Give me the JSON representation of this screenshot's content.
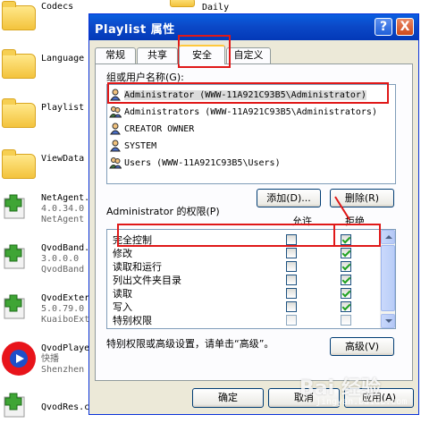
{
  "explorer": {
    "items": [
      {
        "name": "Codecs",
        "sub1": "",
        "sub2": ""
      },
      {
        "name": "Language",
        "sub1": "",
        "sub2": ""
      },
      {
        "name": "Playlist",
        "sub1": "",
        "sub2": ""
      },
      {
        "name": "ViewData",
        "sub1": "",
        "sub2": ""
      },
      {
        "name": "NetAgent.",
        "sub1": "4.0.34.0",
        "sub2": "NetAgent"
      },
      {
        "name": "QvodBand.",
        "sub1": "3.0.0.0",
        "sub2": "QvodBand"
      },
      {
        "name": "QvodExter",
        "sub1": "5.0.79.0",
        "sub2": "KuaiboExt"
      },
      {
        "name": "QvodPlaye",
        "sub1": "快播",
        "sub2": "Shenzhen"
      },
      {
        "name": "QvodRes.c",
        "sub1": "",
        "sub2": ""
      }
    ],
    "top_right_item": "Daily"
  },
  "dialog": {
    "title": "Playlist 属性",
    "help_label": "?",
    "close_label": "X",
    "tabs": [
      {
        "label": "常规"
      },
      {
        "label": "共享"
      },
      {
        "label": "安全"
      },
      {
        "label": "自定义"
      }
    ],
    "group_label": "组或用户名称(G):",
    "users": [
      {
        "name": "Administrator (WWW-11A921C93B5\\Administrator)"
      },
      {
        "name": "Administrators (WWW-11A921C93B5\\Administrators)"
      },
      {
        "name": "CREATOR OWNER"
      },
      {
        "name": "SYSTEM"
      },
      {
        "name": "Users (WWW-11A921C93B5\\Users)"
      }
    ],
    "add_button": "添加(D)...",
    "remove_button": "删除(R)",
    "perm_label": "Administrator 的权限(P)",
    "allow_header": "允许",
    "deny_header": "拒绝",
    "permissions": [
      {
        "name": "完全控制",
        "allow": false,
        "deny": true
      },
      {
        "name": "修改",
        "allow": false,
        "deny": true
      },
      {
        "name": "读取和运行",
        "allow": false,
        "deny": true
      },
      {
        "name": "列出文件夹目录",
        "allow": false,
        "deny": true
      },
      {
        "name": "读取",
        "allow": false,
        "deny": true
      },
      {
        "name": "写入",
        "allow": false,
        "deny": true
      },
      {
        "name": "特别权限",
        "allow": false,
        "deny": false
      }
    ],
    "advanced_hint": "特别权限或高级设置，请单击“高级”。",
    "advanced_button": "高级(V)",
    "ok_button": "确定",
    "cancel_button": "取消",
    "apply_button": "应用(A)"
  },
  "watermark": {
    "text": "Bai 经验",
    "sub": "jingyan.baidu.com"
  },
  "colors": {
    "titlebar": "#0b49c8",
    "dialog_bg": "#ece9d8",
    "annotation_red": "#e01818",
    "check_green": "#21a121"
  }
}
